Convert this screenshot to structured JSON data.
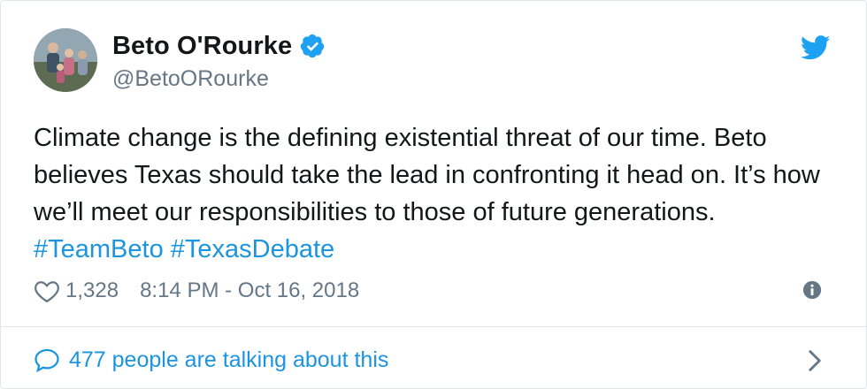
{
  "author": {
    "display_name": "Beto O'Rourke",
    "handle": "@BetoORourke",
    "verified": true
  },
  "tweet": {
    "text_plain": "Climate change is the defining existential threat of our time. Beto believes Texas should take the lead in confronting it head on. It’s how we’ll meet our responsibilities to those of future generations.",
    "hashtags": [
      "#TeamBeto",
      "#TexasDebate"
    ]
  },
  "meta": {
    "like_count": "1,328",
    "timestamp": "8:14 PM - Oct 16, 2018"
  },
  "footer": {
    "conversation_label": "477 people are talking about this"
  },
  "colors": {
    "link": "#1b95e0",
    "text": "#14171a",
    "secondary": "#657786",
    "border": "#e1e8ed"
  },
  "icons": {
    "verified": "verified-badge-icon",
    "brand": "twitter-bird-icon",
    "like": "heart-outline-icon",
    "info": "info-circle-icon",
    "conversation": "speech-bubble-icon",
    "chevron": "chevron-right-icon"
  }
}
